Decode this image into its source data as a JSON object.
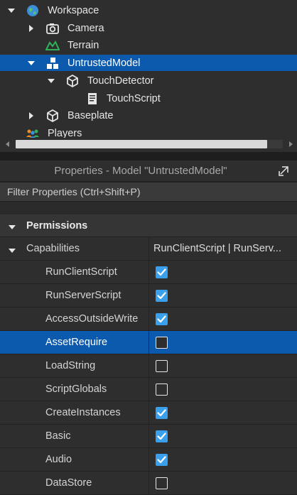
{
  "explorer": {
    "items": [
      {
        "label": "Workspace",
        "icon": "globe-icon",
        "arrow": "expanded"
      },
      {
        "label": "Camera",
        "icon": "camera-icon",
        "arrow": "collapsed"
      },
      {
        "label": "Terrain",
        "icon": "terrain-icon",
        "arrow": "none"
      },
      {
        "label": "UntrustedModel",
        "icon": "model-icon",
        "arrow": "expanded",
        "selected": true
      },
      {
        "label": "TouchDetector",
        "icon": "part-icon",
        "arrow": "expanded"
      },
      {
        "label": "TouchScript",
        "icon": "script-icon",
        "arrow": "none"
      },
      {
        "label": "Baseplate",
        "icon": "part-icon",
        "arrow": "collapsed"
      },
      {
        "label": "Players",
        "icon": "players-icon",
        "arrow": "none"
      }
    ]
  },
  "properties": {
    "title": "Properties - Model \"UntrustedModel\"",
    "filter_placeholder": "Filter Properties (Ctrl+Shift+P)",
    "section": "Permissions",
    "capabilities": {
      "label": "Capabilities",
      "value": "RunClientScript | RunServ..."
    },
    "rows": [
      {
        "name": "RunClientScript",
        "checked": true
      },
      {
        "name": "RunServerScript",
        "checked": true
      },
      {
        "name": "AccessOutsideWrite",
        "checked": true
      },
      {
        "name": "AssetRequire",
        "checked": false,
        "selected": true
      },
      {
        "name": "LoadString",
        "checked": false
      },
      {
        "name": "ScriptGlobals",
        "checked": false
      },
      {
        "name": "CreateInstances",
        "checked": true
      },
      {
        "name": "Basic",
        "checked": true
      },
      {
        "name": "Audio",
        "checked": true
      },
      {
        "name": "DataStore",
        "checked": false
      }
    ]
  },
  "colors": {
    "selection": "#0b5aad",
    "checkbox_on": "#3aa0ec",
    "terrain": "#2fb35a",
    "players": "#f28c1f"
  }
}
